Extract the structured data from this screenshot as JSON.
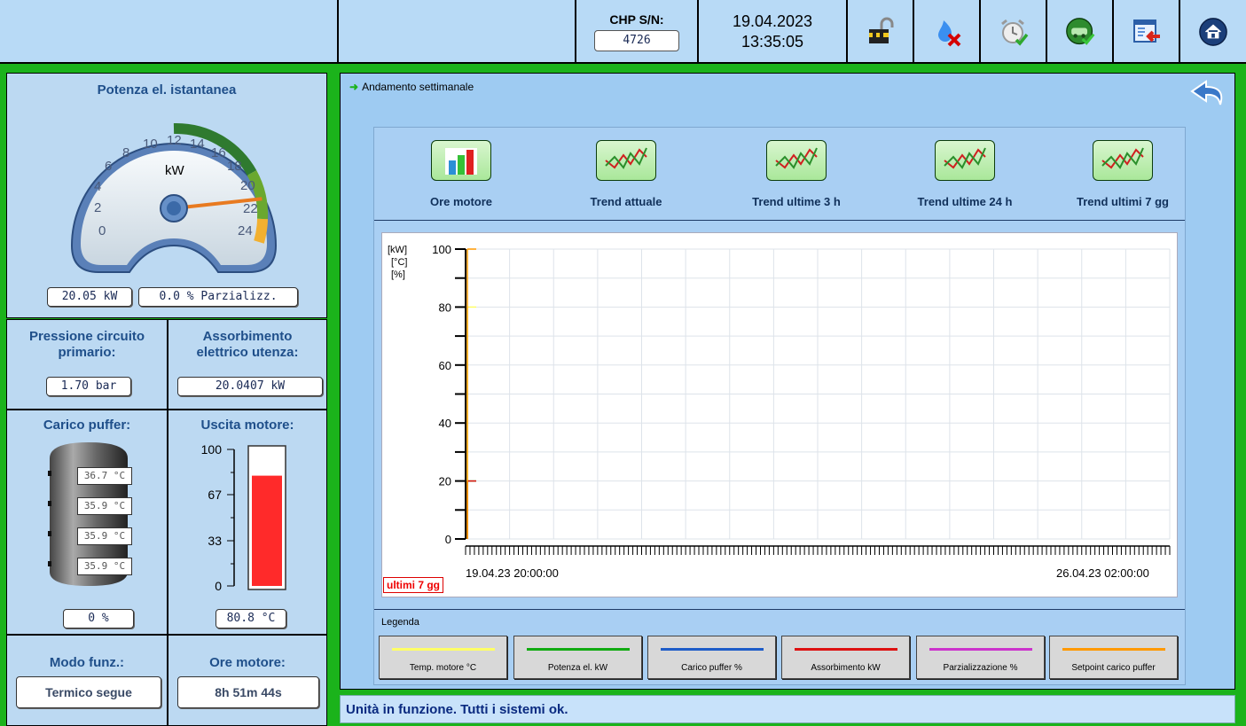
{
  "header": {
    "chp_label": "CHP S/N:",
    "chp_value": "4726",
    "date": "19.04.2023",
    "time": "13:35:05",
    "icons": [
      "unlock-icon",
      "flame-off-icon",
      "alarm-clock-icon",
      "engine-ok-icon",
      "window-exit-icon",
      "home-icon"
    ]
  },
  "left": {
    "power_title": "Potenza el. istantanea",
    "gauge": {
      "unit": "kW",
      "min": 0,
      "max": 24,
      "ticks": [
        "0",
        "2",
        "4",
        "6",
        "8",
        "10",
        "12",
        "14",
        "16",
        "18",
        "20",
        "22",
        "24"
      ],
      "value": 20.05
    },
    "power_value": "20.05 kW",
    "partial_value": "0.0 % Parzializz.",
    "pressure_label": "Pressione circuito primario:",
    "pressure_value": "1.70 bar",
    "absorb_label": "Assorbimento elettrico utenza:",
    "absorb_value": "20.0407 kW",
    "buffer_label": "Carico puffer:",
    "buffer_temps": [
      "36.7 °C",
      "35.9 °C",
      "35.9 °C",
      "35.9 °C"
    ],
    "buffer_value": "0 %",
    "engine_label": "Uscita motore:",
    "engine_scale": [
      "100",
      "67",
      "33",
      "0"
    ],
    "engine_fill_pct": 80.8,
    "engine_value": "80.8 °C",
    "mode_label": "Modo funz.:",
    "mode_value": "Termico segue",
    "hours_label": "Ore motore:",
    "hours_value": "8h 51m 44s"
  },
  "right": {
    "section_title": "Andamento settimanale",
    "tabs": [
      "Ore motore",
      "Trend attuale",
      "Trend ultime 3 h",
      "Trend ultime 24 h",
      "Trend ultimi 7 gg"
    ],
    "units": "[kW]\n[°C]\n[%]",
    "yticks": [
      "100",
      "80",
      "60",
      "40",
      "20",
      "0"
    ],
    "x_start": "19.04.23 20:00:00",
    "x_end": "26.04.23 02:00:00",
    "period_tag": "ultimi 7 gg",
    "legend_title": "Legenda",
    "legend": [
      {
        "label": "Temp. motore °C",
        "color": "#ffff66"
      },
      {
        "label": "Potenza el. kW",
        "color": "#11aa11"
      },
      {
        "label": "Carico puffer %",
        "color": "#1e5cc8"
      },
      {
        "label": "Assorbimento kW",
        "color": "#dd1111"
      },
      {
        "label": "Parzializzazione %",
        "color": "#cc33cc"
      },
      {
        "label": "Setpoint carico puffer",
        "color": "#ff9900"
      }
    ],
    "status": "Unità in funzione. Tutti i sistemi ok."
  },
  "chart_data": {
    "type": "line",
    "ylim": [
      0,
      100
    ],
    "x": [
      "19.04.23 20:00:00",
      "26.04.23 02:00:00"
    ],
    "series": [
      {
        "name": "Temp. motore °C",
        "values": [
          80
        ]
      },
      {
        "name": "Potenza el. kW",
        "values": [
          20
        ]
      },
      {
        "name": "Assorbimento kW",
        "values": [
          20
        ]
      },
      {
        "name": "Setpoint carico puffer",
        "values": [
          100
        ]
      }
    ]
  }
}
